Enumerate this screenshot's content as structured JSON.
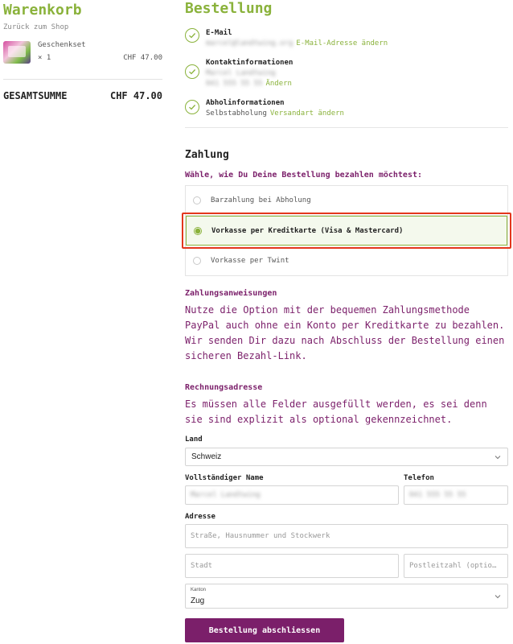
{
  "cart": {
    "title": "Warenkorb",
    "back_link": "Zurück zum Shop",
    "item": {
      "name": "Geschenkset",
      "qty": "× 1",
      "price": "CHF 47.00"
    },
    "total_label": "GESAMTSUMME",
    "total_value": "CHF 47.00"
  },
  "order": {
    "title": "Bestellung",
    "email": {
      "label": "E-Mail",
      "value": "marcel@landtwing.org",
      "link": "E-Mail-Adresse ändern"
    },
    "contact": {
      "label": "Kontaktinformationen",
      "name": "Marcel Landtwing",
      "phone": "041 555 55 55",
      "link": "Ändern"
    },
    "pickup": {
      "label": "Abholinformationen",
      "value": "Selbstabholung",
      "link": "Versandart ändern"
    }
  },
  "payment": {
    "heading": "Zahlung",
    "question": "Wähle, wie Du Deine Bestellung bezahlen möchtest:",
    "options": [
      {
        "label": "Barzahlung bei Abholung",
        "selected": false
      },
      {
        "label": "Vorkasse per Kreditkarte (Visa & Mastercard)",
        "selected": true
      },
      {
        "label": "Vorkasse per Twint",
        "selected": false
      }
    ],
    "instructions_heading": "Zahlungsanweisungen",
    "instructions_text": "Nutze die Option mit der bequemen Zahlungsmethode PayPal auch ohne ein Konto per Kreditkarte zu bezahlen. Wir senden Dir dazu nach Abschluss der Bestellung einen sicheren Bezahl-Link."
  },
  "billing": {
    "heading": "Rechnungsadresse",
    "text": "Es müssen alle Felder ausgefüllt werden, es sei denn sie sind explizit als optional gekennzeichnet.",
    "country_label": "Land",
    "country_value": "Schweiz",
    "name_label": "Vollständiger Name",
    "name_value": "Marcel Landtwing",
    "phone_label": "Telefon",
    "phone_value": "041 555 55 55",
    "address_label": "Adresse",
    "street_placeholder": "Straße, Hausnummer und Stockwerk",
    "city_placeholder": "Stadt",
    "zip_placeholder": "Postleitzahl (optio…",
    "canton_label": "Kanton",
    "canton_value": "Zug"
  },
  "submit_label": "Bestellung abschliessen",
  "colors": {
    "brand_green": "#8ab23b",
    "brand_purple": "#7b1f6a",
    "highlight_red": "#e3361d"
  }
}
